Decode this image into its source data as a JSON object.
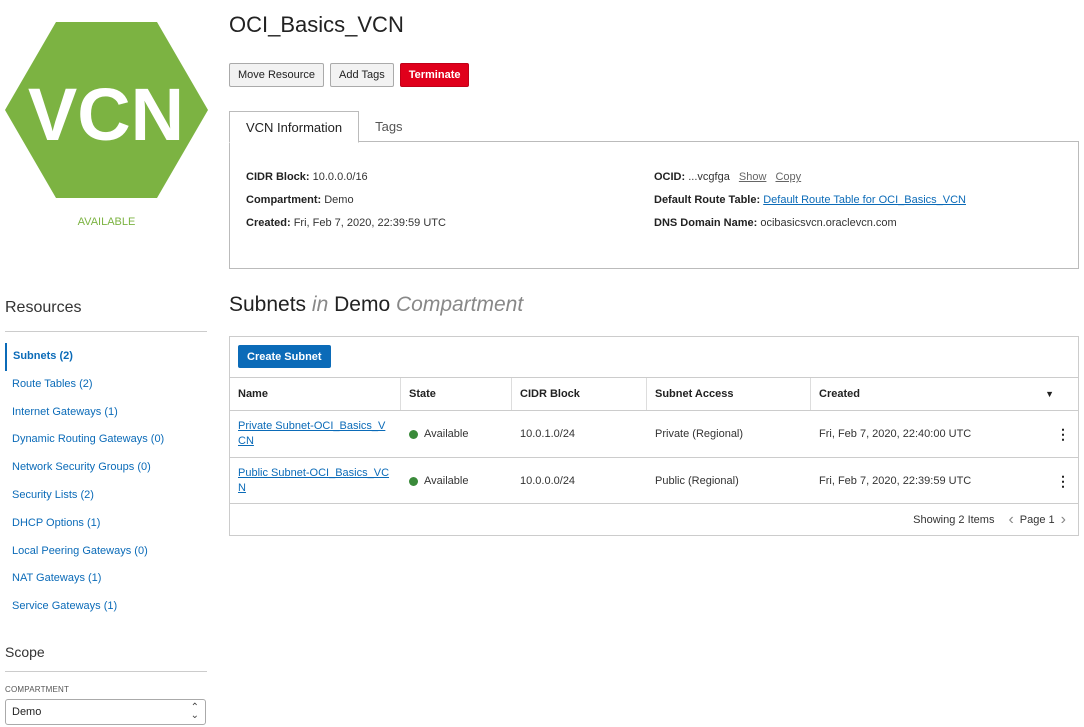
{
  "resource": {
    "icon_text": "VCN",
    "icon_color": "#7cb342",
    "status": "AVAILABLE",
    "status_color": "#7cb342"
  },
  "header": {
    "title": "OCI_Basics_VCN",
    "buttons": {
      "move": "Move Resource",
      "tags": "Add Tags",
      "terminate": "Terminate"
    }
  },
  "tabs": {
    "info": "VCN Information",
    "tags": "Tags"
  },
  "info": {
    "cidr_label": "CIDR Block:",
    "cidr_value": "10.0.0.0/16",
    "compartment_label": "Compartment:",
    "compartment_value": "Demo",
    "created_label": "Created:",
    "created_value": "Fri, Feb 7, 2020, 22:39:59 UTC",
    "ocid_label": "OCID:",
    "ocid_value": "...vcgfga",
    "ocid_show": "Show",
    "ocid_copy": "Copy",
    "route_label": "Default Route Table:",
    "route_value": "Default Route Table for OCI_Basics_VCN",
    "dns_label": "DNS Domain Name:",
    "dns_value": "ocibasicsvcn.oraclevcn.com"
  },
  "sidebar": {
    "resources_title": "Resources",
    "items": [
      "Subnets (2)",
      "Route Tables (2)",
      "Internet Gateways (1)",
      "Dynamic Routing Gateways (0)",
      "Network Security Groups (0)",
      "Security Lists (2)",
      "DHCP Options (1)",
      "Local Peering Gateways (0)",
      "NAT Gateways (1)",
      "Service Gateways (1)"
    ],
    "scope_title": "Scope",
    "compartment_label": "COMPARTMENT",
    "compartment_value": "Demo"
  },
  "subnets": {
    "title_main": "Subnets",
    "title_in": "in",
    "title_comp": "Demo",
    "title_suffix": "Compartment",
    "create_label": "Create Subnet",
    "columns": [
      "Name",
      "State",
      "CIDR Block",
      "Subnet Access",
      "Created"
    ],
    "rows": [
      {
        "name": "Private Subnet-OCI_Basics_VCN",
        "state": "Available",
        "cidr": "10.0.1.0/24",
        "access": "Private (Regional)",
        "created": "Fri, Feb 7, 2020, 22:40:00 UTC"
      },
      {
        "name": "Public Subnet-OCI_Basics_VCN",
        "state": "Available",
        "cidr": "10.0.0.0/24",
        "access": "Public (Regional)",
        "created": "Fri, Feb 7, 2020, 22:39:59 UTC"
      }
    ],
    "footer_count": "Showing 2 Items",
    "footer_page": "Page 1"
  }
}
